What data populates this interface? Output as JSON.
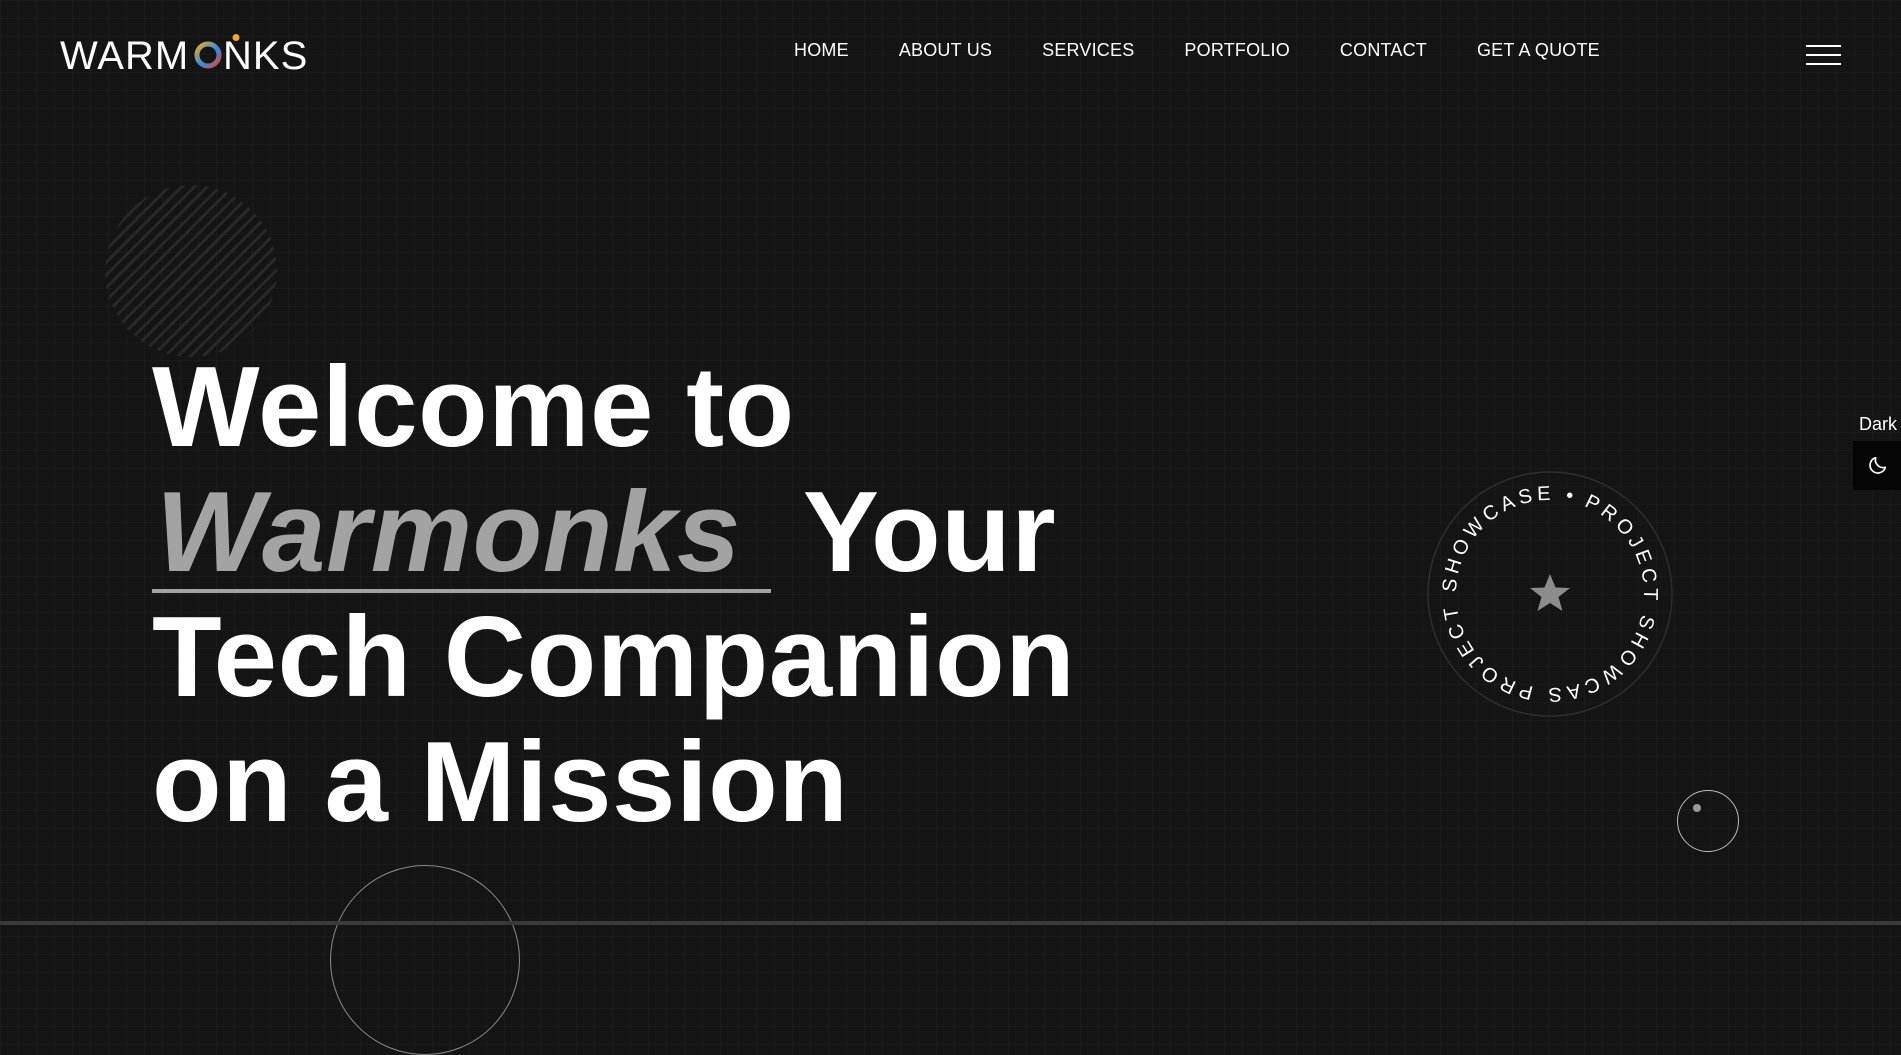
{
  "header": {
    "logo_text": "WARMONKS",
    "logo_colors": {
      "white": "#ffffff",
      "accent_orange": "#f5a623",
      "accent_blue": "#2b8fe3",
      "accent_red": "#e8443a"
    },
    "nav": [
      {
        "label": "HOME"
      },
      {
        "label": "ABOUT US"
      },
      {
        "label": "SERVICES"
      },
      {
        "label": "PORTFOLIO"
      },
      {
        "label": "CONTACT"
      },
      {
        "label": "GET A QUOTE"
      }
    ],
    "menu_icon": "hamburger-icon"
  },
  "hero": {
    "line1": "Welcome to",
    "brand": "Warmonks",
    "line2_rest": "Your",
    "line3": "Tech Companion",
    "line4": "on a Mission",
    "brand_color": "#a3a3a3"
  },
  "badge": {
    "text": "PROJECT SHOWCAS PROJECT SHOWCASE •",
    "center_icon": "star-icon"
  },
  "theme": {
    "label": "Dark",
    "icon": "moon-icon"
  },
  "colors": {
    "background": "#141414",
    "text": "#ffffff",
    "muted": "#a3a3a3"
  }
}
